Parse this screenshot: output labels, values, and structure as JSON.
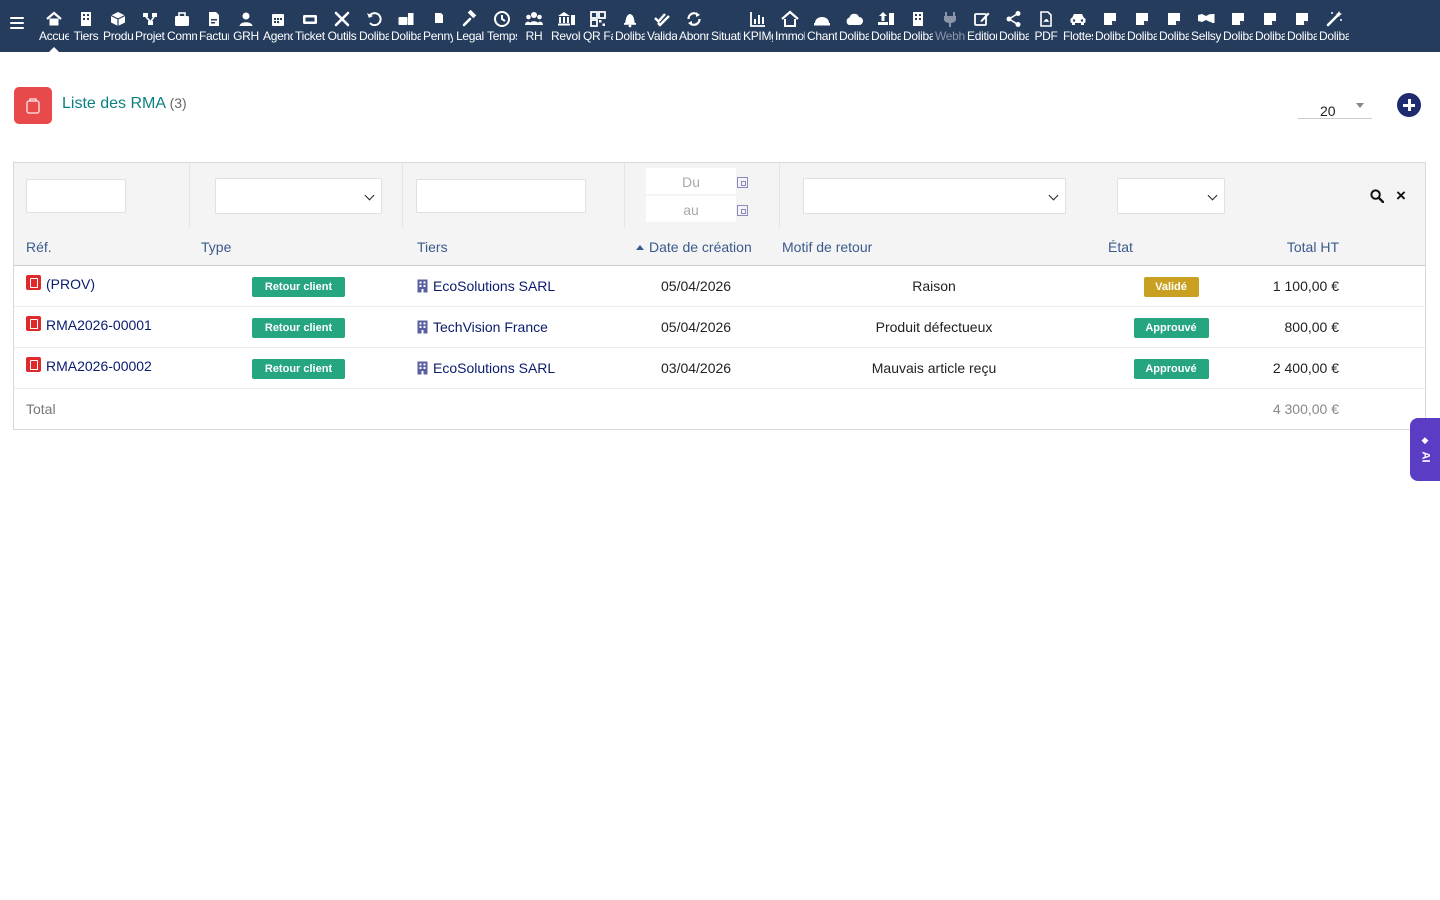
{
  "topmenu": {
    "items": [
      {
        "label": "Accueil",
        "icon": "home-icon"
      },
      {
        "label": "Tiers",
        "icon": "building-icon"
      },
      {
        "label": "Produits",
        "icon": "cube-icon"
      },
      {
        "label": "Projets",
        "icon": "project-icon"
      },
      {
        "label": "Commerce",
        "icon": "briefcase-icon"
      },
      {
        "label": "Facturation",
        "icon": "invoice-icon"
      },
      {
        "label": "GRH",
        "icon": "user-icon"
      },
      {
        "label": "Agenda",
        "icon": "calendar-icon"
      },
      {
        "label": "Tickets",
        "icon": "ticket-icon"
      },
      {
        "label": "Outils",
        "icon": "tools-icon"
      },
      {
        "label": "Dolibarr",
        "icon": "undo-icon"
      },
      {
        "label": "Dolibarr",
        "icon": "case-icon"
      },
      {
        "label": "Pennylane",
        "icon": "doc-icon"
      },
      {
        "label": "Legal",
        "icon": "gavel-icon"
      },
      {
        "label": "Temps",
        "icon": "clock-icon"
      },
      {
        "label": "RH",
        "icon": "users-icon"
      },
      {
        "label": "Revolut",
        "icon": "bank-icon"
      },
      {
        "label": "QR Factures",
        "icon": "qrcode-icon"
      },
      {
        "label": "Dolibarr",
        "icon": "bell-icon"
      },
      {
        "label": "Validation",
        "icon": "check-double-icon"
      },
      {
        "label": "Abonnements",
        "icon": "sync-icon"
      },
      {
        "label": "Situations",
        "icon": "blank-icon"
      },
      {
        "label": "KPIMgr",
        "icon": "chart-icon"
      },
      {
        "label": "Immobilier",
        "icon": "house-icon"
      },
      {
        "label": "Chantiers",
        "icon": "hardhat-icon"
      },
      {
        "label": "Dolibarr",
        "icon": "cloud-icon"
      },
      {
        "label": "Dolibarr",
        "icon": "upload-icon"
      },
      {
        "label": "Dolibarr",
        "icon": "building-icon"
      },
      {
        "label": "Webhooks",
        "icon": "plug-icon",
        "dim": true
      },
      {
        "label": "Edition",
        "icon": "edit-icon"
      },
      {
        "label": "Dolibarr",
        "icon": "share-icon"
      },
      {
        "label": "PDF",
        "icon": "pdf-icon"
      },
      {
        "label": "Flottes",
        "icon": "car-icon"
      },
      {
        "label": "Dolibarr",
        "icon": "note-icon"
      },
      {
        "label": "Dolibarr",
        "icon": "note-icon"
      },
      {
        "label": "Dolibarr",
        "icon": "note-icon"
      },
      {
        "label": "Sellsy",
        "icon": "handshake-icon"
      },
      {
        "label": "Dolibarr",
        "icon": "note-icon"
      },
      {
        "label": "Dolibarr",
        "icon": "note-icon"
      },
      {
        "label": "Dolibarr",
        "icon": "note-icon"
      },
      {
        "label": "Dolibarr",
        "icon": "magic-icon"
      }
    ]
  },
  "header": {
    "title": "Liste des RMA",
    "count": "(3)",
    "limit": "20"
  },
  "filters": {
    "date_from_placeholder": "Du",
    "date_to_placeholder": "au"
  },
  "columns": {
    "ref": "Réf.",
    "type": "Type",
    "tiers": "Tiers",
    "date": "Date de création",
    "motif": "Motif de retour",
    "etat": "État",
    "total": "Total HT"
  },
  "rows": [
    {
      "ref": "(PROV)",
      "type": "Retour client",
      "tiers": "EcoSolutions SARL",
      "date": "05/04/2026",
      "motif": "Raison",
      "etat": "Validé",
      "etat_color": "#c9a022",
      "total": "1 100,00 €"
    },
    {
      "ref": "RMA2026-00001",
      "type": "Retour client",
      "tiers": "TechVision France",
      "date": "05/04/2026",
      "motif": "Produit défectueux",
      "etat": "Approuvé",
      "etat_color": "#25a580",
      "total": "800,00 €"
    },
    {
      "ref": "RMA2026-00002",
      "type": "Retour client",
      "tiers": "EcoSolutions SARL",
      "date": "03/04/2026",
      "motif": "Mauvais article reçu",
      "etat": "Approuvé",
      "etat_color": "#25a580",
      "total": "2 400,00 €"
    }
  ],
  "totals": {
    "label": "Total",
    "value": "4 300,00 €"
  },
  "ai_tab": {
    "label": "AI"
  },
  "colors": {
    "topbar": "#263c5c",
    "accent": "#0c8080",
    "badge_type": "#25a580",
    "rma_icon": "#e8494b"
  }
}
